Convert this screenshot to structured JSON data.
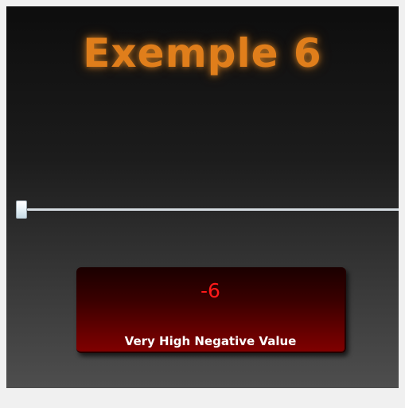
{
  "title": "Exemple 6",
  "slider": {
    "value": -6,
    "level_fraction": 0
  },
  "result": {
    "value": "-6",
    "label": "Very High Negative Value",
    "value_color": "#ff1a1a",
    "box_color": "#800000"
  },
  "colors": {
    "title": "#e07e1b",
    "track": "#d6dde2"
  }
}
